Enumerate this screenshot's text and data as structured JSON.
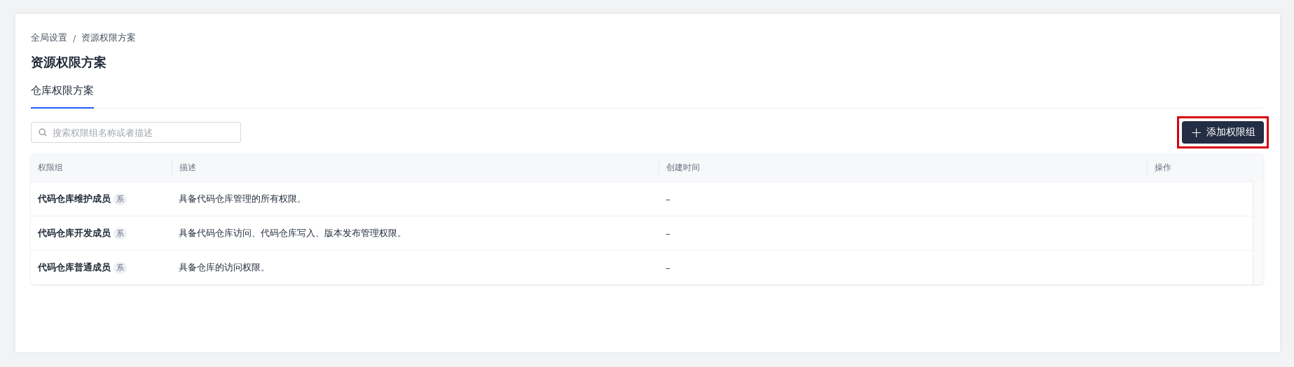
{
  "breadcrumb": [
    {
      "label": "全局设置"
    },
    {
      "label": "资源权限方案"
    }
  ],
  "breadcrumb_separator": "/",
  "title": "资源权限方案",
  "tabs": [
    {
      "label": "仓库权限方案",
      "selected": true
    }
  ],
  "search": {
    "placeholder": "搜索权限组名称或者描述"
  },
  "add_button": {
    "icon": "+",
    "label": "添加权限组",
    "highlighted": true
  },
  "table": {
    "columns": [
      "权限组",
      "描述",
      "创建时间",
      "操作"
    ],
    "rows": [
      {
        "name": "代码仓库维护成员",
        "badge": "系",
        "description": "具备代码仓库管理的所有权限。",
        "created": "–"
      },
      {
        "name": "代码仓库开发成员",
        "badge": "系",
        "description": "具备代码仓库访问、代码仓库写入、版本发布管理权限。",
        "created": "–"
      },
      {
        "name": "代码仓库普通成员",
        "badge": "系",
        "description": "具备仓库的访问权限。",
        "created": "–"
      }
    ]
  }
}
